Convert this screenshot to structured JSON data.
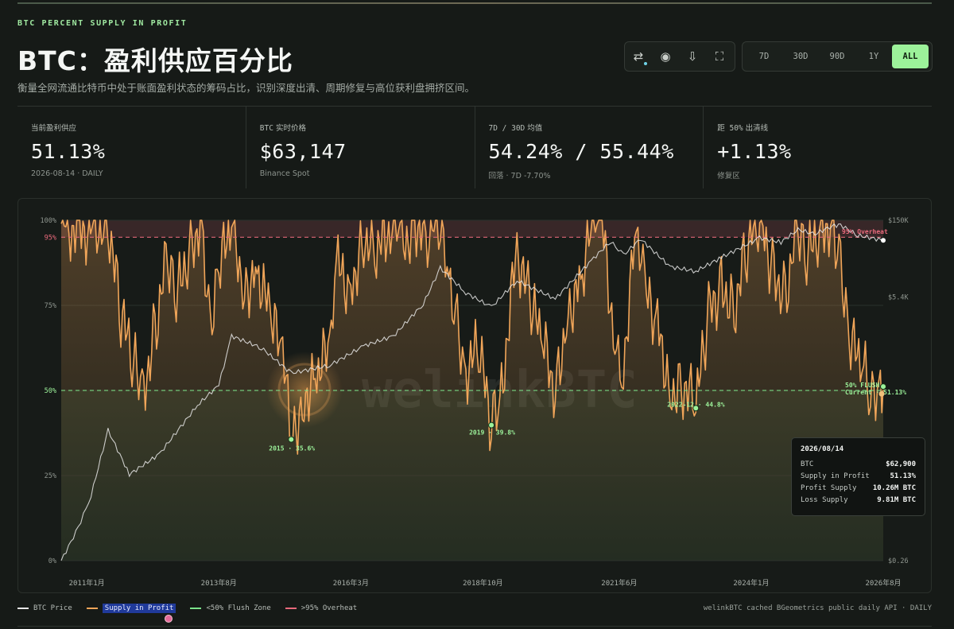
{
  "header": {
    "eyebrow": "BTC PERCENT SUPPLY IN PROFIT",
    "title": "BTC：盈利供应百分比",
    "subtitle": "衡量全网流通比特币中处于账面盈利状态的筹码占比，识别深度出清、周期修复与高位获利盘拥挤区间。"
  },
  "toolbar": {
    "tools": [
      {
        "name": "swap-icon",
        "glyph": "⇄"
      },
      {
        "name": "record-icon",
        "glyph": "◉"
      },
      {
        "name": "download-icon",
        "glyph": "⇩"
      },
      {
        "name": "fullscreen-icon",
        "glyph": "⛶"
      }
    ],
    "ranges": [
      "7D",
      "30D",
      "90D",
      "1Y",
      "ALL"
    ],
    "active_range": "ALL",
    "accent": "#9cf29a"
  },
  "stats": [
    {
      "label_prefix": "",
      "label": "当前盈利供应",
      "value": "51.13%",
      "sub": "2026-08-14 · DAILY"
    },
    {
      "label_prefix": "BTC",
      "label": "实时价格",
      "value": "$63,147",
      "sub": "Binance Spot"
    },
    {
      "label_prefix": "7D / 30D",
      "label": "均值",
      "value": "54.24% / 55.44%",
      "sub": "回落 · 7D -7.70%"
    },
    {
      "label_prefix": "距 50%",
      "label": "出清线",
      "value": "+1.13%",
      "sub": "修复区"
    }
  ],
  "chart_data": {
    "type": "line",
    "title": "",
    "xlabel": "",
    "ylabel": "",
    "x_ticks": [
      "2011年1月",
      "2013年8月",
      "2016年3月",
      "2018年10月",
      "2021年6月",
      "2024年1月",
      "2026年8月"
    ],
    "x_range": [
      "2010-07",
      "2026-08"
    ],
    "y_left_ticks": [
      "100%",
      "95%",
      "75%",
      "50%",
      "25%",
      "0%"
    ],
    "y_left_range": [
      0,
      100
    ],
    "y_right_ticks": [
      "$150K",
      "$5.4K",
      "$0.26"
    ],
    "y_right_scale": "log",
    "y_right_range": [
      0.06,
      150000
    ],
    "grid": true,
    "legend_position": "bottom",
    "thresholds": [
      {
        "name": "<50% Flush Zone",
        "value": 50,
        "color": "#7be38a"
      },
      {
        "name": ">95% Overheat",
        "value": 95,
        "color": "#e8697b"
      }
    ],
    "series": [
      {
        "name": "Supply in Profit",
        "axis": "left",
        "color": "#f0a559",
        "points": [
          [
            "2010-07",
            99
          ],
          [
            "2010-11",
            97
          ],
          [
            "2011-03",
            98
          ],
          [
            "2011-06",
            100
          ],
          [
            "2011-09",
            72
          ],
          [
            "2011-12",
            58
          ],
          [
            "2012-02",
            48
          ],
          [
            "2012-05",
            68
          ],
          [
            "2012-08",
            90
          ],
          [
            "2012-10",
            76
          ],
          [
            "2013-01",
            92
          ],
          [
            "2013-04",
            100
          ],
          [
            "2013-06",
            70
          ],
          [
            "2013-08",
            84
          ],
          [
            "2013-11",
            100
          ],
          [
            "2014-02",
            80
          ],
          [
            "2014-05",
            86
          ],
          [
            "2014-08",
            72
          ],
          [
            "2014-11",
            60
          ],
          [
            "2015-01",
            36
          ],
          [
            "2015-04",
            48
          ],
          [
            "2015-07",
            55
          ],
          [
            "2015-10",
            62
          ],
          [
            "2015-12",
            86
          ],
          [
            "2016-03",
            80
          ],
          [
            "2016-06",
            96
          ],
          [
            "2016-09",
            90
          ],
          [
            "2017-01",
            100
          ],
          [
            "2017-03",
            92
          ],
          [
            "2017-06",
            100
          ],
          [
            "2017-09",
            96
          ],
          [
            "2017-12",
            100
          ],
          [
            "2018-02",
            78
          ],
          [
            "2018-04",
            70
          ],
          [
            "2018-06",
            56
          ],
          [
            "2018-09",
            62
          ],
          [
            "2018-12",
            40
          ],
          [
            "2019-02",
            46
          ],
          [
            "2019-06",
            92
          ],
          [
            "2019-09",
            76
          ],
          [
            "2019-12",
            64
          ],
          [
            "2020-03",
            50
          ],
          [
            "2020-06",
            74
          ],
          [
            "2020-09",
            82
          ],
          [
            "2020-12",
            100
          ],
          [
            "2021-02",
            99
          ],
          [
            "2021-05",
            64
          ],
          [
            "2021-07",
            58
          ],
          [
            "2021-10",
            98
          ],
          [
            "2021-12",
            78
          ],
          [
            "2022-03",
            70
          ],
          [
            "2022-06",
            50
          ],
          [
            "2022-09",
            52
          ],
          [
            "2022-12",
            45
          ],
          [
            "2023-03",
            72
          ],
          [
            "2023-06",
            82
          ],
          [
            "2023-09",
            74
          ],
          [
            "2023-12",
            92
          ],
          [
            "2024-03",
            100
          ],
          [
            "2024-06",
            86
          ],
          [
            "2024-09",
            78
          ],
          [
            "2024-12",
            100
          ],
          [
            "2025-02",
            88
          ],
          [
            "2025-05",
            98
          ],
          [
            "2025-08",
            99
          ],
          [
            "2025-10",
            90
          ],
          [
            "2025-12",
            64
          ],
          [
            "2026-03",
            58
          ],
          [
            "2026-05",
            48
          ],
          [
            "2026-07",
            54
          ],
          [
            "2026-08",
            51.13
          ]
        ]
      },
      {
        "name": "BTC Price",
        "axis": "right",
        "color": "#e6e6e6",
        "points": [
          [
            "2010-07",
            0.06
          ],
          [
            "2010-11",
            0.25
          ],
          [
            "2011-02",
            1
          ],
          [
            "2011-06",
            17
          ],
          [
            "2011-11",
            2.5
          ],
          [
            "2012-06",
            6
          ],
          [
            "2013-03",
            50
          ],
          [
            "2013-08",
            120
          ],
          [
            "2013-11",
            1000
          ],
          [
            "2014-06",
            600
          ],
          [
            "2015-01",
            200
          ],
          [
            "2015-10",
            280
          ],
          [
            "2016-06",
            650
          ],
          [
            "2017-01",
            1000
          ],
          [
            "2017-08",
            4000
          ],
          [
            "2017-12",
            19000
          ],
          [
            "2018-06",
            6500
          ],
          [
            "2018-12",
            3500
          ],
          [
            "2019-06",
            11000
          ],
          [
            "2020-03",
            5000
          ],
          [
            "2020-12",
            29000
          ],
          [
            "2021-04",
            60000
          ],
          [
            "2021-07",
            33000
          ],
          [
            "2021-11",
            67000
          ],
          [
            "2022-06",
            20000
          ],
          [
            "2022-12",
            16500
          ],
          [
            "2023-06",
            30000
          ],
          [
            "2024-03",
            70000
          ],
          [
            "2024-08",
            58000
          ],
          [
            "2024-12",
            100000
          ],
          [
            "2025-04",
            82000
          ],
          [
            "2025-08",
            118000
          ],
          [
            "2025-10",
            122000
          ],
          [
            "2026-02",
            78000
          ],
          [
            "2026-08",
            62900
          ]
        ]
      }
    ],
    "markers": [
      {
        "label": "2015 · 35.6%",
        "x": "2015-01",
        "y": 35.6
      },
      {
        "label": "2019 · 39.8%",
        "x": "2018-12",
        "y": 39.8
      },
      {
        "label": "2022-12 · 44.8%",
        "x": "2022-12",
        "y": 44.8
      },
      {
        "label": "Current · 51.13%",
        "x": "2026-08",
        "y": 51.13
      }
    ],
    "annotations": [
      {
        "label": "95% Overheat",
        "color": "#e8697b"
      },
      {
        "label": "50% FLUSH",
        "color": "#7be38a"
      }
    ]
  },
  "tooltip": {
    "date": "2026/08/14",
    "rows": [
      {
        "k": "BTC",
        "v": "$62,900"
      },
      {
        "k": "Supply in Profit",
        "v": "51.13%"
      },
      {
        "k": "Profit Supply",
        "v": "10.26M BTC"
      },
      {
        "k": "Loss Supply",
        "v": "9.81M BTC"
      }
    ]
  },
  "watermark": "welinkBTC",
  "legend": [
    {
      "name": "BTC Price",
      "color": "#e6e6e6"
    },
    {
      "name": "Supply in Profit",
      "color": "#f0a559"
    },
    {
      "name": "<50% Flush Zone",
      "color": "#7be38a"
    },
    {
      "name": ">95% Overheat",
      "color": "#e8697b"
    }
  ],
  "credit": "welinkBTC cached BGeometrics public daily API · DAILY"
}
